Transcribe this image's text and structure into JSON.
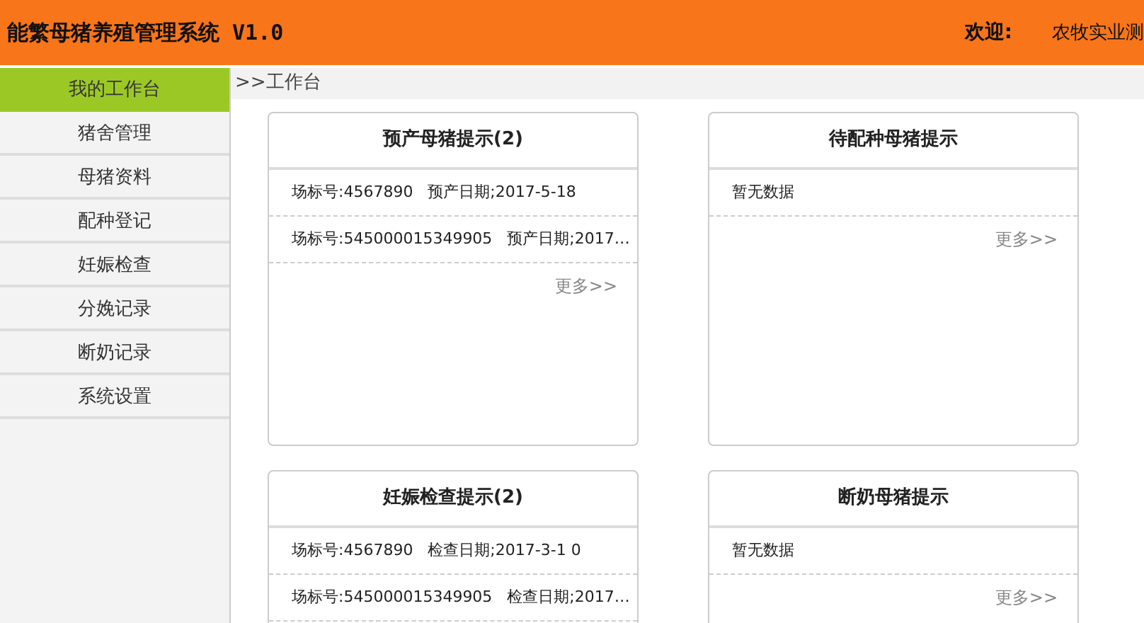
{
  "header": {
    "title": "能繁母猪养殖管理系统 V1.0",
    "welcome_label": "欢迎:",
    "user": "农牧实业测"
  },
  "sidebar": {
    "items": [
      {
        "label": "我的工作台",
        "selected": true
      },
      {
        "label": "猪舍管理",
        "selected": false
      },
      {
        "label": "母猪资料",
        "selected": false
      },
      {
        "label": "配种登记",
        "selected": false
      },
      {
        "label": "妊娠检查",
        "selected": false
      },
      {
        "label": "分娩记录",
        "selected": false
      },
      {
        "label": "断奶记录",
        "selected": false
      },
      {
        "label": "系统设置",
        "selected": false
      }
    ]
  },
  "breadcrumb": ">>工作台",
  "cards": [
    {
      "title": "预产母猪提示(2)",
      "rows": [
        "场标号:4567890   预产日期;2017-5-18",
        "场标号:545000015349905   预产日期;2017…"
      ],
      "more": "更多>>"
    },
    {
      "title": "待配种母猪提示",
      "rows": [
        "暂无数据"
      ],
      "more": "更多>>"
    },
    {
      "title": "妊娠检查提示(2)",
      "rows": [
        "场标号:4567890   检查日期;2017-3-1 0",
        "场标号:545000015349905   检查日期;2017…"
      ]
    },
    {
      "title": "断奶母猪提示",
      "rows": [
        "暂无数据"
      ],
      "more": "更多>>"
    }
  ]
}
